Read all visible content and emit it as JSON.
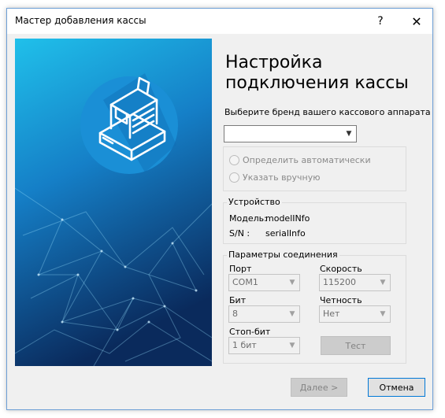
{
  "window": {
    "title": "Мастер добавления кассы",
    "help_glyph": "?",
    "close_glyph": "✕"
  },
  "heading": {
    "line1": "Настройка",
    "line2": "подключения кассы"
  },
  "brand": {
    "prompt": "Выберите бренд вашего кассового аппарата",
    "value": ""
  },
  "mode": {
    "auto": "Определить автоматически",
    "manual": "Указать вручную"
  },
  "device": {
    "caption": "Устройство",
    "model_label": "Модель:",
    "model_value": "modelINfo",
    "sn_label": "S/N :",
    "sn_value": "serialInfo"
  },
  "connection": {
    "caption": "Параметры соединения",
    "port_label": "Порт",
    "port_value": "COM1",
    "speed_label": "Скорость",
    "speed_value": "115200",
    "bits_label": "Бит",
    "bits_value": "8",
    "parity_label": "Четность",
    "parity_value": "Нет",
    "stopbits_label": "Стоп-бит",
    "stopbits_value": "1 бит",
    "test_label": "Тест"
  },
  "footer": {
    "next_label": "Далее >",
    "cancel_label": "Отмена"
  },
  "colors": {
    "accent": "#0078d7",
    "banner_top": "#1fb5e6",
    "banner_bottom": "#0b2b5e",
    "icon_circle": "#1a8fd6"
  },
  "icons": {
    "banner": "cash-register-icon",
    "dropdown": "chevron-down-icon"
  }
}
